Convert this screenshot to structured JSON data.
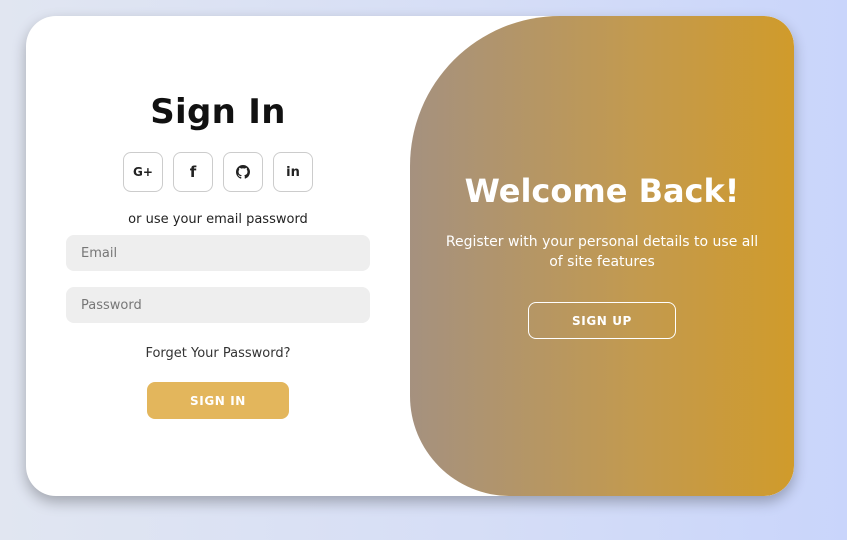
{
  "signin": {
    "title": "Sign In",
    "socials": [
      {
        "icon": "google-plus-icon",
        "glyph": "G+"
      },
      {
        "icon": "facebook-icon",
        "glyph": "f"
      },
      {
        "icon": "github-icon",
        "glyph": ""
      },
      {
        "icon": "linkedin-icon",
        "glyph": "in"
      }
    ],
    "alt_text": "or use your email password",
    "email_placeholder": "Email",
    "password_placeholder": "Password",
    "forgot_text": "Forget Your Password?",
    "button_label": "SIGN IN"
  },
  "toggle": {
    "title": "Welcome Back!",
    "text": "Register with your personal details to use all of site features",
    "button_label": "SIGN UP"
  },
  "colors": {
    "accent": "#e3b65c",
    "panel_start": "#a5917f",
    "panel_end": "#d09b2b"
  }
}
